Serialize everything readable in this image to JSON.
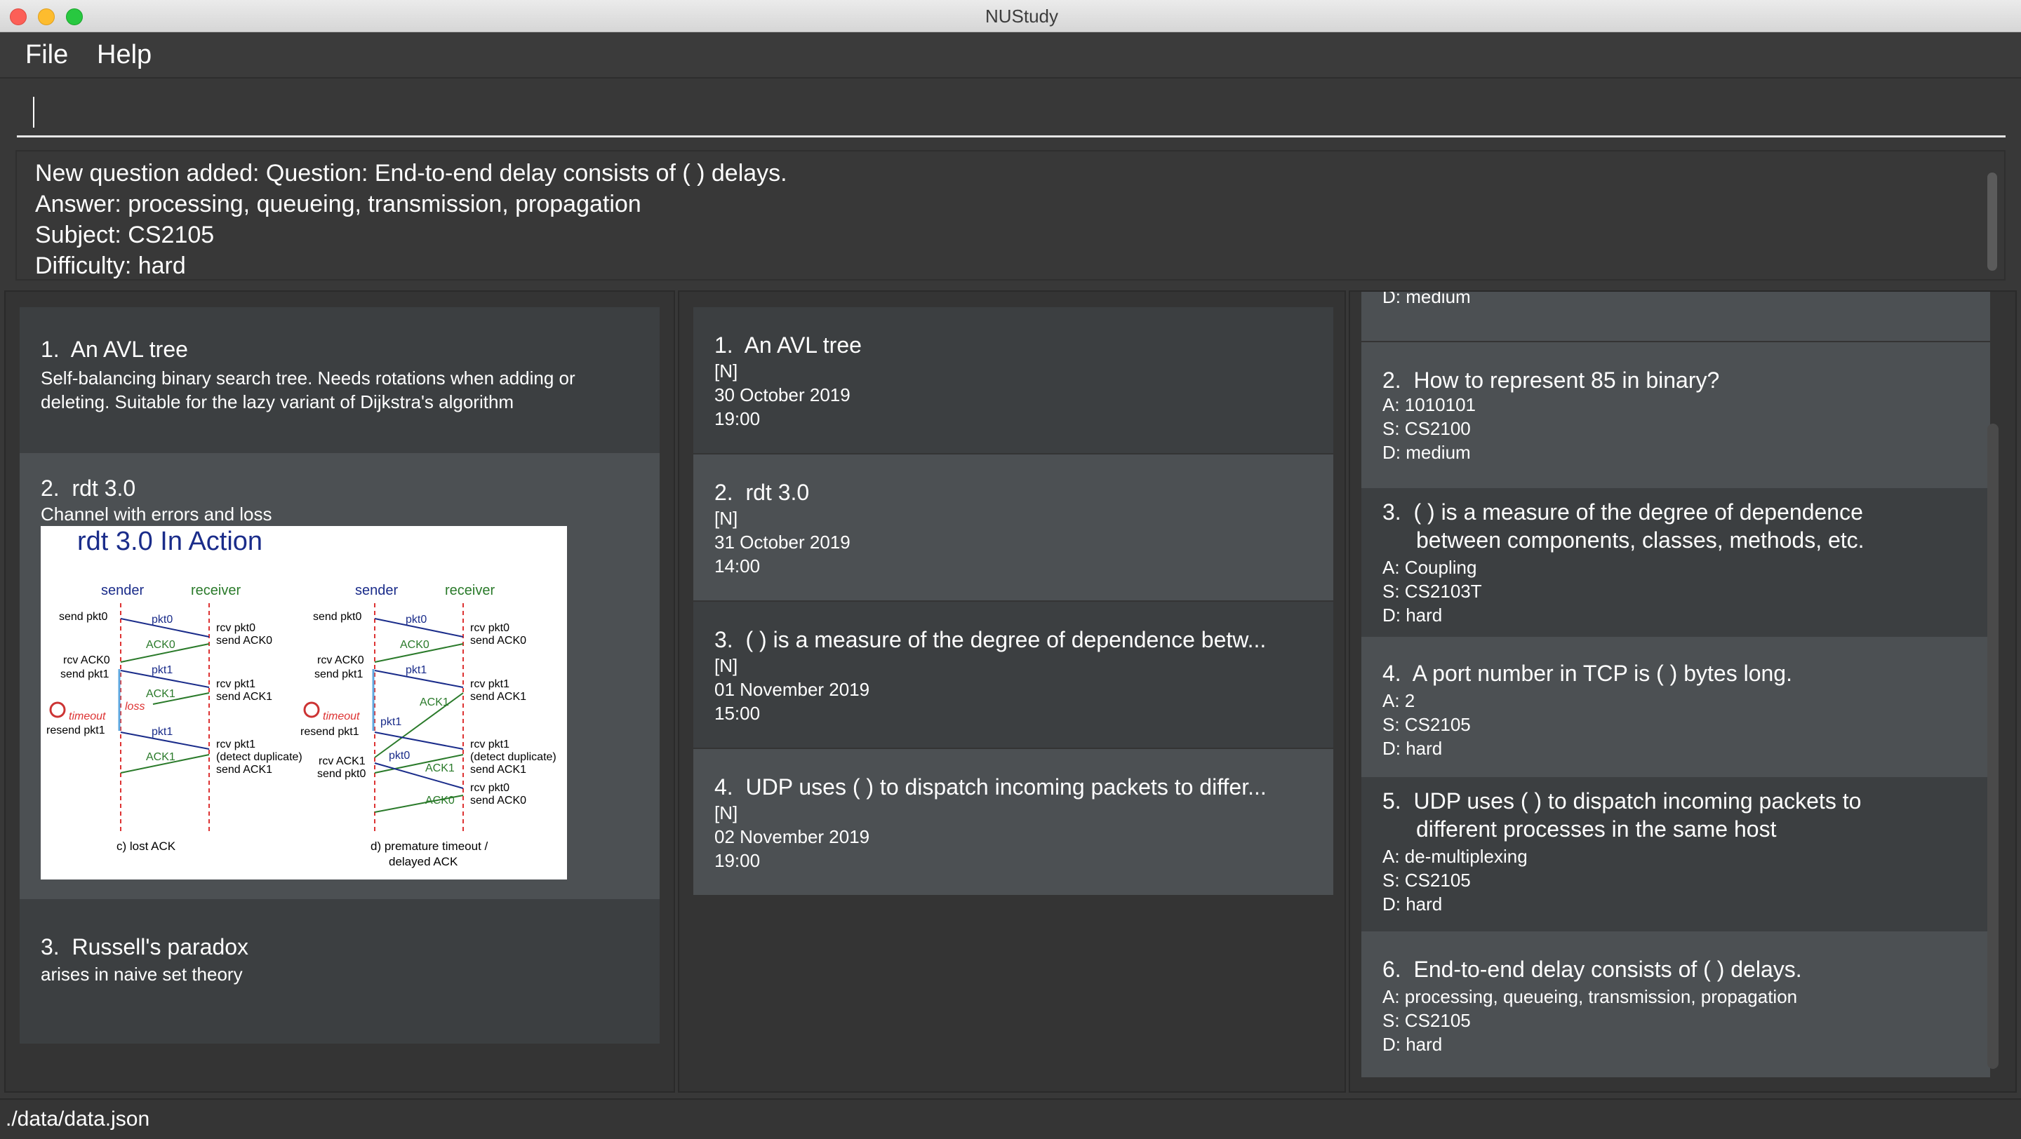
{
  "window": {
    "title": "NUStudy"
  },
  "menu": {
    "file": "File",
    "help": "Help"
  },
  "command": {
    "value": ""
  },
  "result": {
    "line1": "New question added: Question: End-to-end delay consists of (  ) delays.",
    "line2": "Answer: processing, queueing, transmission, propagation",
    "line3": "Subject: CS2105",
    "line4": "Difficulty: hard"
  },
  "notes": [
    {
      "index": "1.",
      "title": "An AVL tree",
      "content": "Self-balancing binary search tree. Needs rotations when adding or deleting. Suitable for the lazy variant of Dijkstra's algorithm"
    },
    {
      "index": "2.",
      "title": "rdt 3.0",
      "content": "Channel with errors and loss",
      "image": {
        "heading": "rdt 3.0 In Action",
        "sender": "sender",
        "receiver": "receiver",
        "caption_c": "c)  lost ACK",
        "caption_d1": "d)  premature timeout /",
        "caption_d2": "delayed ACK",
        "left_labels": [
          "send pkt0",
          "rcv ACK0",
          "send pkt1",
          "timeout",
          "resend pkt1"
        ],
        "right_labels": [
          "send pkt0",
          "rcv ACK0",
          "send pkt1",
          "timeout",
          "resend pkt1",
          "rcv ACK1",
          "send pkt0"
        ],
        "recv_c": [
          "rcv pkt0",
          "send ACK0",
          "rcv pkt1",
          "send ACK1",
          "rcv pkt1",
          "(detect duplicate)",
          "send ACK1"
        ],
        "recv_d": [
          "rcv pkt0",
          "send ACK0",
          "rcv pkt1",
          "send ACK1",
          "rcv pkt1",
          "(detect duplicate)",
          "send ACK1",
          "rcv pkt0",
          "send ACK0"
        ],
        "arrows_c": [
          "pkt0",
          "ACK0",
          "pkt1",
          "ACK1",
          "loss",
          "pkt1",
          "ACK1"
        ],
        "arrows_d": [
          "pkt0",
          "ACK0",
          "pkt1",
          "ACK1",
          "pkt1",
          "pkt0",
          "ACK1",
          "ACK0"
        ]
      }
    },
    {
      "index": "3.",
      "title": "Russell's paradox",
      "content": "arises in naive set theory"
    }
  ],
  "events": [
    {
      "index": "1.",
      "title": "An AVL tree",
      "tag": "[N]",
      "date": "30 October 2019",
      "time": "19:00"
    },
    {
      "index": "2.",
      "title": "rdt 3.0",
      "tag": "[N]",
      "date": "31 October 2019",
      "time": "14:00"
    },
    {
      "index": "3.",
      "title": "(  ) is a measure of the degree of dependence betw...",
      "tag": "[N]",
      "date": "01 November 2019",
      "time": "15:00"
    },
    {
      "index": "4.",
      "title": "UDP uses (  ) to dispatch incoming packets to differ...",
      "tag": "[N]",
      "date": "02 November 2019",
      "time": "19:00"
    }
  ],
  "questions": {
    "partial_top": "D: medium",
    "items": [
      {
        "index": "2.",
        "title": "How to represent 85 in binary?",
        "answer": "A: 1010101",
        "subject": "S: CS2100",
        "difficulty": "D: medium"
      },
      {
        "index": "3.",
        "title": "(  ) is a measure of the degree of dependence",
        "title2": "between components, classes, methods, etc.",
        "answer": "A: Coupling",
        "subject": "S: CS2103T",
        "difficulty": "D: hard"
      },
      {
        "index": "4.",
        "title": "A port number in TCP is (  ) bytes long.",
        "answer": "A: 2",
        "subject": "S: CS2105",
        "difficulty": "D: hard"
      },
      {
        "index": "5.",
        "title": "UDP uses (  ) to dispatch incoming packets to",
        "title2": "different processes in the same host",
        "answer": "A: de-multiplexing",
        "subject": "S: CS2105",
        "difficulty": "D: hard"
      },
      {
        "index": "6.",
        "title": "End-to-end delay consists of (  ) delays.",
        "answer": "A: processing, queueing, transmission, propagation",
        "subject": "S: CS2105",
        "difficulty": "D: hard"
      }
    ]
  },
  "status": {
    "path": "./data/data.json"
  }
}
